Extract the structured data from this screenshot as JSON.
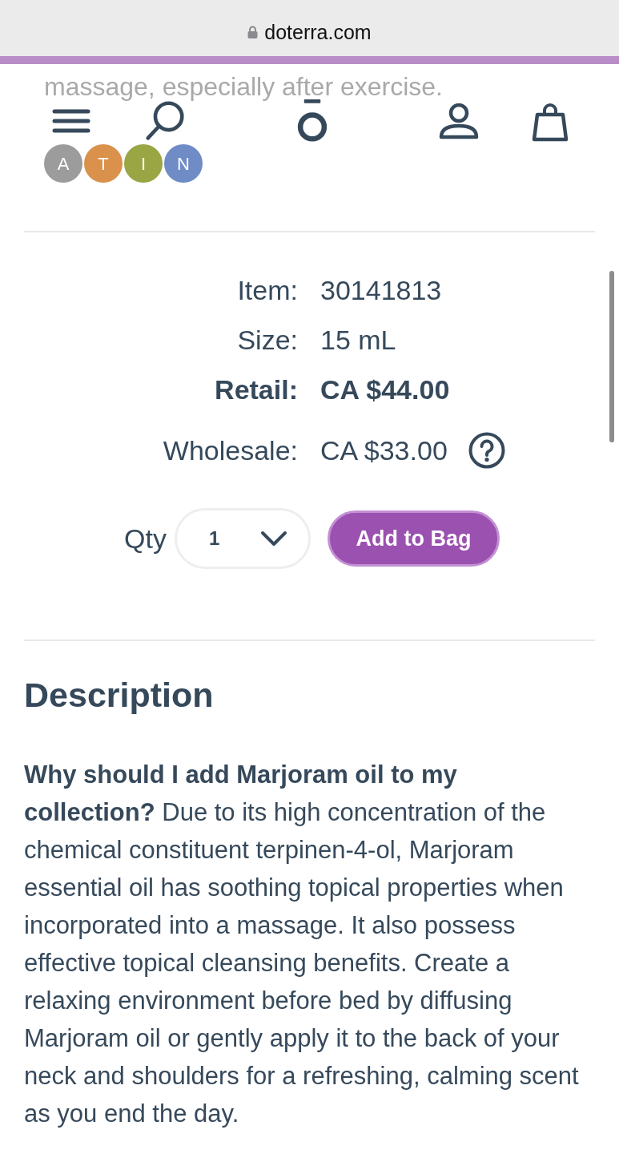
{
  "browser": {
    "url": "doterra.com"
  },
  "background_content": {
    "text": "massage, especially after exercise.",
    "badges": [
      {
        "letter": "A",
        "color": "#9c9c9c"
      },
      {
        "letter": "T",
        "color": "#d9914c"
      },
      {
        "letter": "I",
        "color": "#9aa544"
      },
      {
        "letter": "N",
        "color": "#6f8cc6"
      }
    ]
  },
  "details": [
    {
      "label": "Item:",
      "value": "30141813",
      "kind": "plain"
    },
    {
      "label": "Size:",
      "value": "15 mL",
      "kind": "plain"
    },
    {
      "label": "Retail:",
      "value": "CA $44.00",
      "kind": "bold"
    },
    {
      "label": "Wholesale:",
      "value": "CA $33.00",
      "kind": "help"
    }
  ],
  "purchase": {
    "qty_label": "Qty",
    "quantity": "1",
    "button": "Add to Bag"
  },
  "description": {
    "title": "Description",
    "text": "**Why should I add Marjoram oil to my collection?** Due to its high concentration of the chemical constituent terpinen-4-ol, Marjoram essential oil has soothing topical properties when incorporated into a massage. It also possess effective topical cleansing benefits. Create a relaxing environment before bed by diffusing Marjoram oil or gently apply it to the back of your neck and shoulders for a refreshing, calming scent as you end the day."
  }
}
